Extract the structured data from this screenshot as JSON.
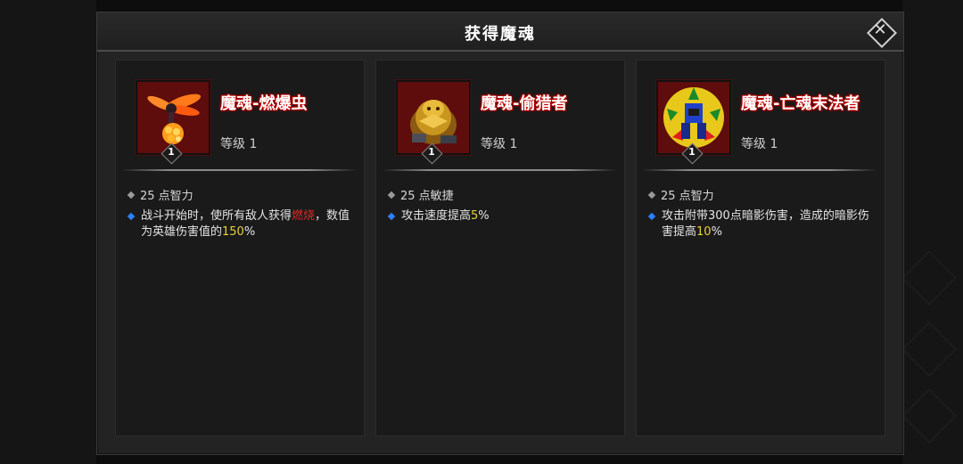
{
  "dialog": {
    "title": "获得魔魂",
    "close_label": "✕"
  },
  "souls": [
    {
      "name": "魔魂-燃爆虫",
      "level_text": "等级 1",
      "level_badge": "1",
      "icon": "firefly-bug-icon",
      "stat": "25 点智力",
      "effect_before": "战斗开始时，使所有敌人获得",
      "effect_red": "燃烧",
      "effect_mid": "，数值为英雄伤害值的",
      "effect_yellow": "150",
      "effect_after": "%"
    },
    {
      "name": "魔魂-偷猎者",
      "level_text": "等级 1",
      "level_badge": "1",
      "icon": "golden-beast-icon",
      "stat": "25 点敏捷",
      "effect_before": "攻击速度提高",
      "effect_yellow": "5",
      "effect_after": "%"
    },
    {
      "name": "魔魂-亡魂末法者",
      "level_text": "等级 1",
      "level_badge": "1",
      "icon": "undead-mage-icon",
      "stat": "25 点智力",
      "effect_before": "攻击附带300点暗影伤害，造成的暗影伤害提高",
      "effect_yellow": "10",
      "effect_after": "%"
    }
  ],
  "colors": {
    "highlight_red": "#e02a2a",
    "highlight_yellow": "#e6d23a",
    "bullet_blue": "#2f7fff",
    "icon_frame": "#6b0f0f"
  }
}
